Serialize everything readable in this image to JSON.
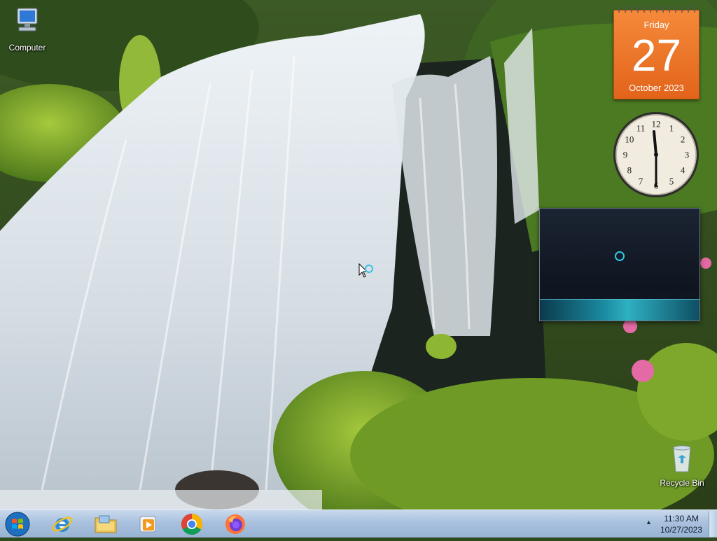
{
  "desktop": {
    "icons": [
      {
        "label": "Computer",
        "icon": "computer-icon"
      },
      {
        "label": "Recycle Bin",
        "icon": "recycle-bin-icon"
      }
    ]
  },
  "gadgets": {
    "calendar": {
      "weekday": "Friday",
      "day": "27",
      "month_year": "October 2023",
      "color": "#ec7427"
    },
    "clock": {
      "numerals": [
        "12",
        "1",
        "2",
        "3",
        "4",
        "5",
        "6",
        "7",
        "8",
        "9",
        "10",
        "11"
      ]
    },
    "media": {
      "accent": "#2fb0c3"
    }
  },
  "taskbar": {
    "start_icon": "windows-logo-icon",
    "pinned": [
      {
        "name": "Internet Explorer",
        "icon": "internet-explorer-icon"
      },
      {
        "name": "File Explorer",
        "icon": "folder-icon"
      },
      {
        "name": "Windows Media Player",
        "icon": "media-player-icon"
      },
      {
        "name": "Google Chrome",
        "icon": "chrome-icon"
      },
      {
        "name": "Firefox",
        "icon": "firefox-icon"
      }
    ],
    "tray": {
      "time": "11:30 AM",
      "date": "10/27/2023",
      "arrow": "▲"
    }
  }
}
